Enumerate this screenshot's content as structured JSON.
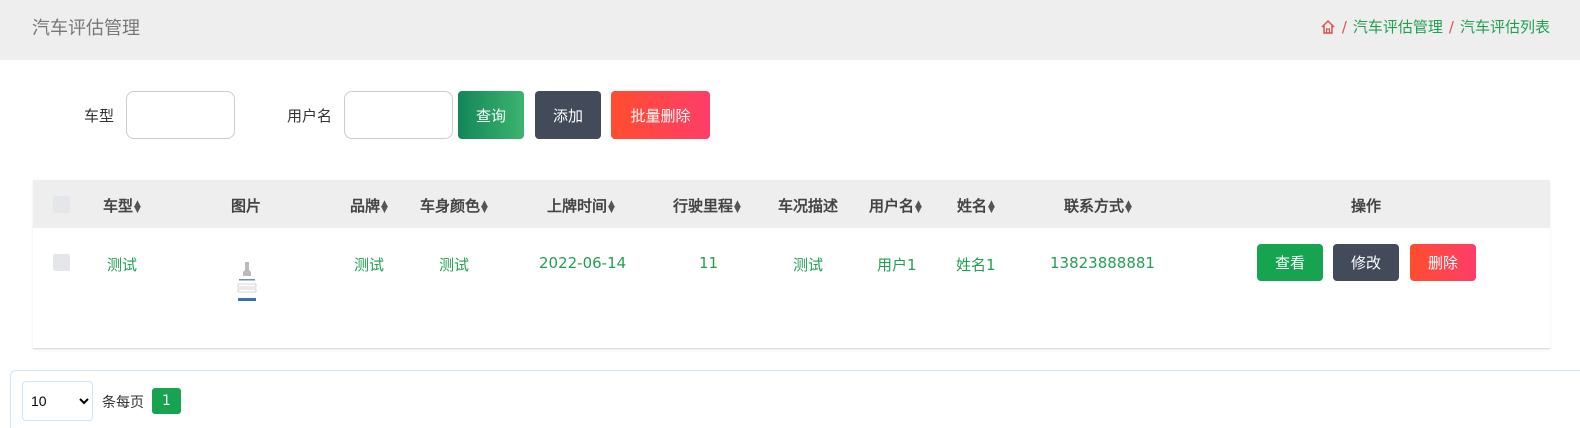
{
  "header": {
    "title": "汽车评估管理",
    "breadcrumb": [
      "汽车评估管理",
      "汽车评估列表"
    ],
    "breadcrumb_sep": "/",
    "home_icon": "home-icon"
  },
  "search": {
    "car_model_label": "车型",
    "car_model_value": "",
    "username_label": "用户名",
    "username_value": "",
    "query_label": "查询",
    "add_label": "添加",
    "batch_delete_label": "批量删除"
  },
  "table": {
    "columns": [
      "车型",
      "图片",
      "品牌",
      "车身颜色",
      "上牌时间",
      "行驶里程",
      "车况描述",
      "用户名",
      "姓名",
      "联系方式",
      "操作"
    ],
    "rows": [
      {
        "car_model": "测试",
        "image": "thumbnail",
        "brand": "测试",
        "color": "测试",
        "plate_date": "2022-06-14",
        "mileage": "11",
        "condition": "测试",
        "username": "用户1",
        "name": "姓名1",
        "phone": "13823888881",
        "actions": {
          "view": "查看",
          "edit": "修改",
          "delete": "删除"
        }
      }
    ]
  },
  "pager": {
    "page_size": "10",
    "page_size_options": [
      "10"
    ],
    "per_page_label": "条每页",
    "current_page": "1"
  },
  "colors": {
    "accent_green": "#22a052",
    "button_dark": "#434a5a",
    "button_red": "#ff4d4f",
    "header_bg": "#eeeeee"
  }
}
